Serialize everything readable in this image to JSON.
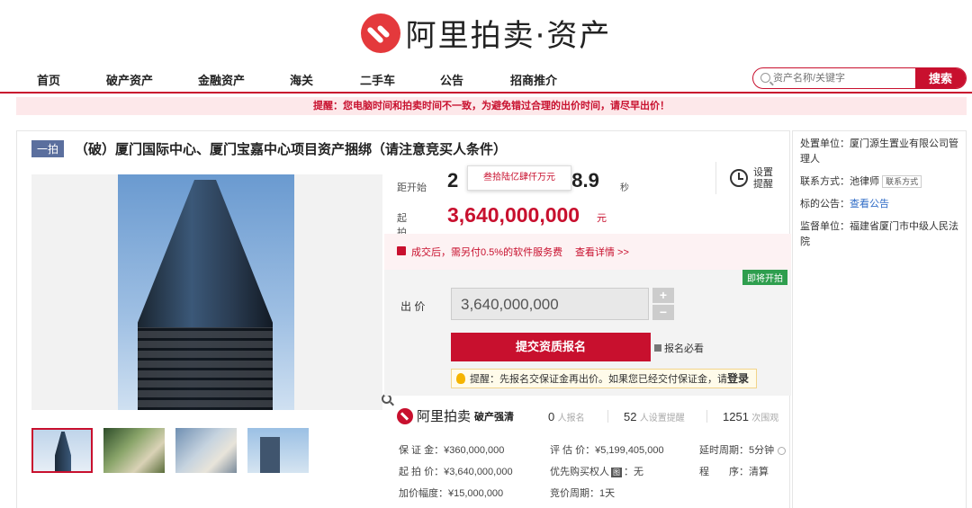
{
  "logo": {
    "text": "阿里拍卖·资产"
  },
  "nav": {
    "items": [
      "首页",
      "破产资产",
      "金融资产",
      "海关",
      "二手车",
      "公告",
      "招商推介"
    ],
    "search_placeholder": "资产名称/关键字",
    "search_button": "搜索"
  },
  "warning": "提醒：您电脑时间和拍卖时间不一致，为避免错过合理的出价时间，请尽早出价！",
  "item": {
    "tag": "一拍",
    "title": "（破）厦门国际中心、厦门宝嘉中心项目资产捆绑（请注意竞买人条件）"
  },
  "auction": {
    "countdown_label": "距开始",
    "countdown_prefix": "2",
    "countdown_value": "08.9",
    "countdown_unit": "秒",
    "tooltip": "叁拾陆亿肆仟万元",
    "alarm_label": "设置提醒",
    "start_price_label": "起拍价",
    "start_price": "3,640,000,000",
    "price_unit": "元",
    "fee_text": "成交后，需另付0.5%的软件服务费",
    "fee_link": "查看详情 >>",
    "soon_badge": "即将开拍",
    "bid_label": "出 价",
    "bid_value": "3,640,000,000",
    "stepper_up": "+",
    "stepper_down": "−",
    "submit_button": "提交资质报名",
    "must_read": "报名必看",
    "tip_text": "提醒：先报名交保证金再出价。如果您已经交付保证金，请",
    "tip_link": "登录"
  },
  "stats": {
    "brand": "阿里拍卖",
    "brand_badge": "破产强清",
    "signup_count": "0",
    "signup_label": "人报名",
    "remind_count": "52",
    "remind_label": "人设置提醒",
    "view_count": "1251",
    "view_label": "次围观"
  },
  "details": {
    "deposit": "保 证 金：¥360,000,000",
    "appraisal": "评 估 价：¥5,199,405,000",
    "delay": "延时周期：5分钟",
    "start_price": "起 拍 价：¥3,640,000,000",
    "priority": "优先购买权人",
    "priority_badge": "图",
    "priority_value": "：无",
    "procedure_label": "程　　序：",
    "procedure_value": "清算",
    "increment": "加价幅度：¥15,000,000",
    "bid_period": "竞价周期：1天"
  },
  "side": {
    "disposer_label": "处置单位：",
    "disposer": "厦门源生置业有限公司管理人",
    "contact_label": "联系方式：",
    "contact_name": "池律师",
    "contact_button": "联系方式",
    "notice_label": "标的公告：",
    "notice_link": "查看公告",
    "supervisor_label": "监督单位：",
    "supervisor": "福建省厦门市中级人民法院"
  },
  "colors": {
    "brand_red": "#c8102e",
    "tag_blue": "#5b6f9e",
    "soon_green": "#2e9e4e"
  }
}
